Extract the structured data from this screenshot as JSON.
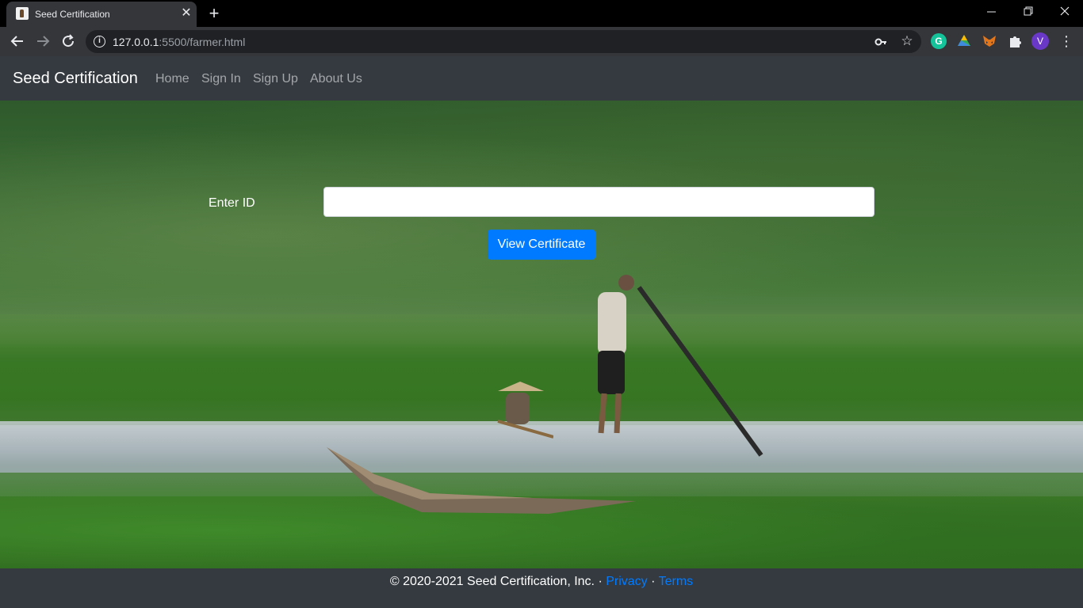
{
  "browser": {
    "tab_title": "Seed Certification",
    "url_host": "127.0.0.1",
    "url_rest": ":5500/farmer.html",
    "avatar_initial": "V"
  },
  "navbar": {
    "brand": "Seed Certification",
    "links": [
      "Home",
      "Sign In",
      "Sign Up",
      "About Us"
    ]
  },
  "form": {
    "id_label": "Enter ID",
    "id_value": "",
    "submit_label": "View Certificate"
  },
  "footer": {
    "copyright": "© 2020-2021 Seed Certification, Inc. · ",
    "privacy": "Privacy",
    "separator": " · ",
    "terms": "Terms"
  },
  "colors": {
    "navbar_bg": "#343a40",
    "primary": "#007bff",
    "tab_bg": "#35363a",
    "avatar_bg": "#6a38c7"
  }
}
